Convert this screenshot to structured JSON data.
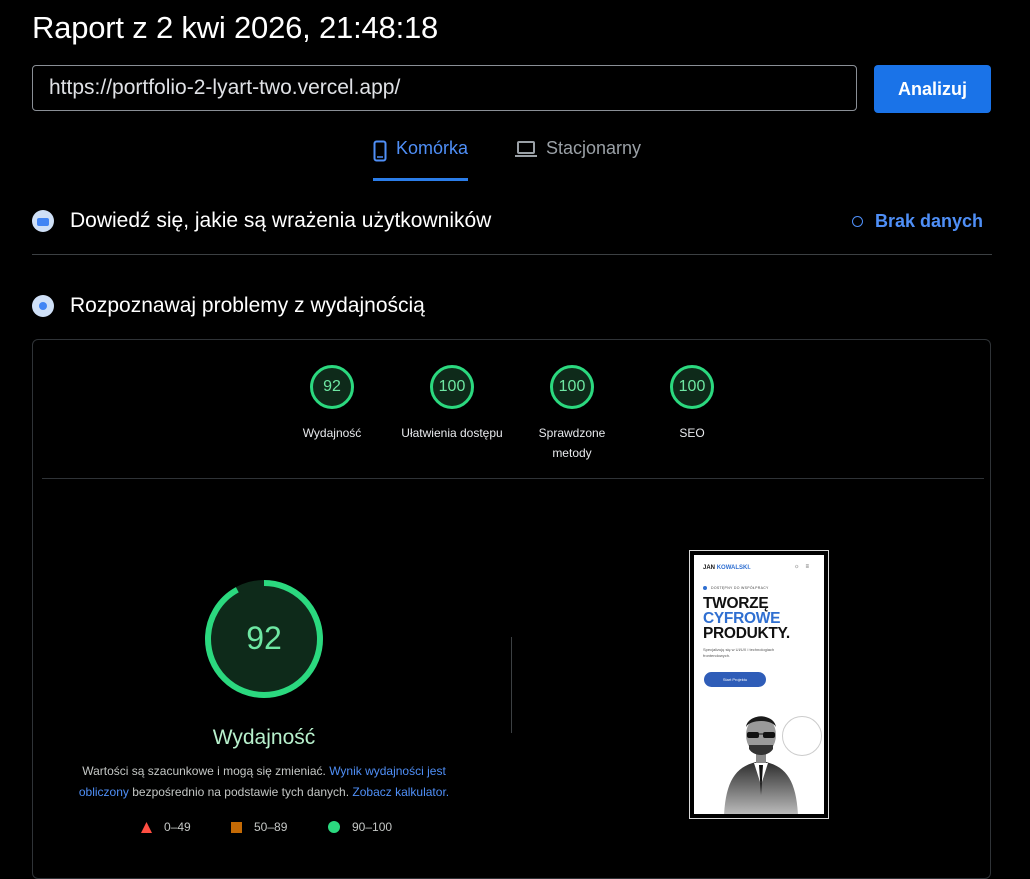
{
  "header": {
    "title": "Raport z 2 kwi 2026, 21:48:18",
    "url_value": "https://portfolio-2-lyart-two.vercel.app/",
    "analyze_label": "Analizuj"
  },
  "tabs": [
    {
      "label": "Komórka",
      "icon": "smartphone-icon",
      "active": true
    },
    {
      "label": "Stacjonarny",
      "icon": "laptop-icon",
      "active": false
    }
  ],
  "field_data": {
    "title": "Dowiedź się, jakie są wrażenia użytkowników",
    "status": "Brak danych"
  },
  "lab_data": {
    "title": "Rozpoznawaj problemy z wydajnością",
    "categories": [
      {
        "score": "92",
        "label": "Wydajność"
      },
      {
        "score": "100",
        "label": "Ułatwienia dostępu"
      },
      {
        "score": "100",
        "label": "Sprawdzone metody"
      },
      {
        "score": "100",
        "label": "SEO"
      }
    ],
    "main_score": {
      "value": 92,
      "label": "Wydajność"
    },
    "description": {
      "text1": "Wartości są szacunkowe i mogą się zmieniać. ",
      "link1": "Wynik wydajności jest obliczony",
      "text2": " bezpośrednio na podstawie tych danych. ",
      "link2": "Zobacz kalkulator."
    },
    "legend": [
      {
        "range": "0–49",
        "shape": "triangle",
        "color": "#ff4e42"
      },
      {
        "range": "50–89",
        "shape": "square",
        "color": "#c46a05"
      },
      {
        "range": "90–100",
        "shape": "circle",
        "color": "#2bd97f"
      }
    ]
  },
  "screenshot": {
    "logo_first": "JAN",
    "logo_second": "KOWALSKI",
    "logo_dot": ".",
    "tagline": "DOSTĘPNY DO WSPÓŁPRACY",
    "headline_1": "TWORZĘ",
    "headline_2": "CYFROWE",
    "headline_3": "PRODUKTY.",
    "subtitle": "Specjalizuję się w UI/UX i technologiach frontendowych.",
    "cta": "Start Projektu"
  }
}
